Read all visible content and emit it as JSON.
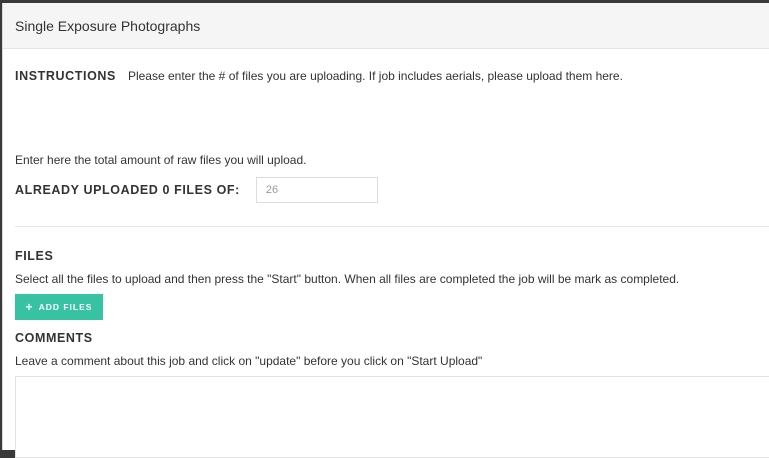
{
  "panel": {
    "title": "Single Exposure Photographs"
  },
  "instructions": {
    "label": "INSTRUCTIONS",
    "text": "Please enter the # of files you are uploading. If job includes aerials, please upload them here."
  },
  "raw_files": {
    "text": "Enter here the total amount of raw files you will upload.",
    "uploaded_label": "ALREADY UPLOADED 0 FILES OF:",
    "count_value": "26"
  },
  "files": {
    "title": "FILES",
    "text": "Select all the files to upload and then press the \"Start\" button. When all files are completed the job will be mark as completed.",
    "add_button_label": "ADD FILES",
    "add_button_icon": "plus-icon"
  },
  "comments": {
    "title": "COMMENTS",
    "text": "Leave a comment about this job and click on \"update\" before you click on \"Start Upload\"",
    "value": ""
  },
  "colors": {
    "accent": "#36c2a3",
    "header_bg": "#f5f5f5"
  }
}
